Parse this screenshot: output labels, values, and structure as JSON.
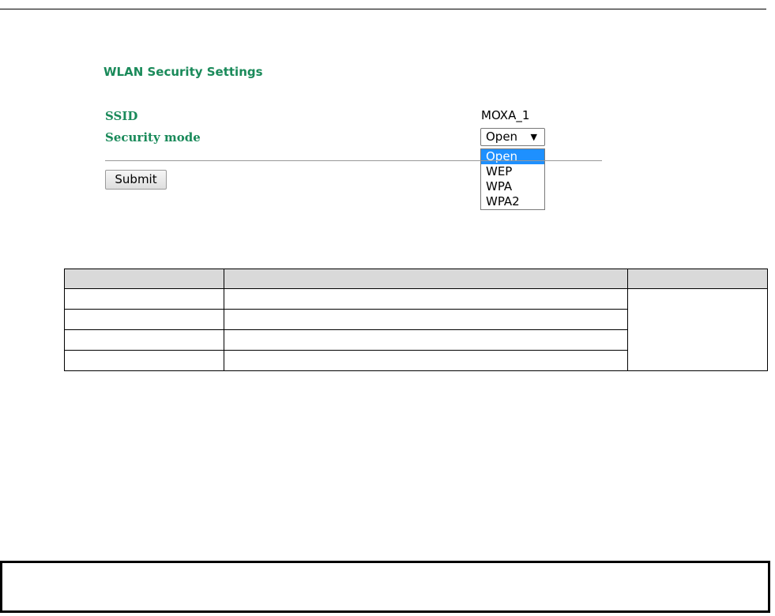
{
  "form": {
    "title": "WLAN Security Settings",
    "ssid_label": "SSID",
    "ssid_value": "MOXA_1",
    "security_mode_label": "Security mode",
    "security_mode_selected": "Open",
    "security_mode_arrow": "▼",
    "security_mode_options": [
      "Open",
      "WEP",
      "WPA",
      "WPA2"
    ],
    "submit_label": "Submit"
  },
  "colors": {
    "label_green": "#1a8a5a",
    "option_highlight": "#1e90ff",
    "table_header": "#d9d9d9"
  }
}
